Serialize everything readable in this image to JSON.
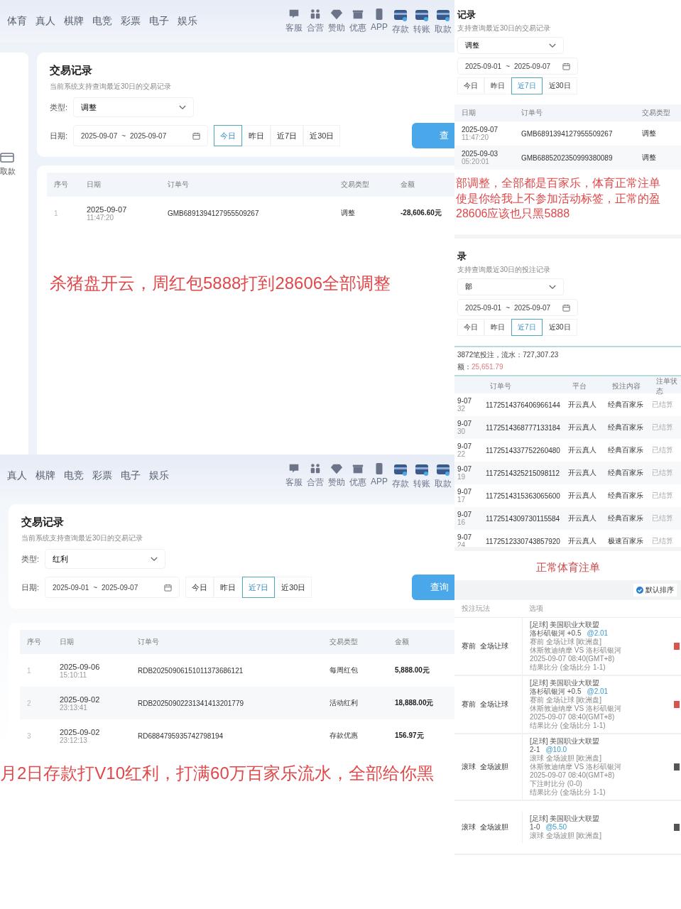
{
  "top_left": {
    "nav_links": [
      "体育",
      "真人",
      "棋牌",
      "电竞",
      "彩票",
      "电子",
      "娱乐"
    ],
    "nav_icons": [
      "客服",
      "合营",
      "赞助",
      "优惠",
      "APP",
      "存款",
      "转账",
      "取款"
    ],
    "sidebar_label": "取款",
    "title": "交易记录",
    "subtitle": "当前系统支持查询最近30日的交易记录",
    "type_label": "类型:",
    "type_value": "调整",
    "date_label": "日期:",
    "date_start": "2025-09-07",
    "date_sep": "~",
    "date_end": "2025-09-07",
    "quick_ranges": [
      {
        "label": "今日",
        "selected": true
      },
      {
        "label": "昨日",
        "selected": false
      },
      {
        "label": "近7日",
        "selected": false
      },
      {
        "label": "近30日",
        "selected": false
      }
    ],
    "query_button": "查",
    "columns": [
      {
        "kind": "index",
        "label": "序号"
      },
      {
        "kind": "date",
        "label": "日期"
      },
      {
        "kind": "order_no",
        "label": "订单号"
      },
      {
        "kind": "type",
        "label": "交易类型"
      },
      {
        "kind": "amount",
        "label": "金额"
      }
    ],
    "rows": [
      {
        "index": "1",
        "date": "2025-09-07",
        "time": "11:47:20",
        "order_no": "GMB6891394127955509267",
        "type": "调整",
        "amount": "-28,606.60元"
      }
    ],
    "annotation": [
      "杀猪盘开云，周红包5888打到28606全部调整"
    ]
  },
  "bottom_left": {
    "nav_links": [
      "真人",
      "棋牌",
      "电竞",
      "彩票",
      "电子",
      "娱乐"
    ],
    "nav_icons": [
      "客服",
      "合营",
      "赞助",
      "优惠",
      "APP",
      "存款",
      "转账",
      "取款"
    ],
    "title": "交易记录",
    "subtitle": "当前系统支持查询最近30日的交易记录",
    "type_label": "类型:",
    "type_value": "红利",
    "date_label": "日期:",
    "date_start": "2025-09-01",
    "date_sep": "~",
    "date_end": "2025-09-07",
    "quick_ranges": [
      {
        "label": "今日",
        "selected": false
      },
      {
        "label": "昨日",
        "selected": false
      },
      {
        "label": "近7日",
        "selected": true
      },
      {
        "label": "近30日",
        "selected": false
      }
    ],
    "query_button": "查询",
    "columns": [
      {
        "kind": "index",
        "label": "序号"
      },
      {
        "kind": "date",
        "label": "日期"
      },
      {
        "kind": "order_no",
        "label": "订单号"
      },
      {
        "kind": "type",
        "label": "交易类型"
      },
      {
        "kind": "amount",
        "label": "金额"
      }
    ],
    "rows": [
      {
        "index": "1",
        "date": "2025-09-06",
        "time": "15:10:11",
        "order_no": "RDB20250906151011373686121",
        "type": "每周红包",
        "amount": "5,888.00元"
      },
      {
        "index": "2",
        "date": "2025-09-02",
        "time": "23:13:41",
        "order_no": "RDB20250902231341413201779",
        "type": "活动红利",
        "amount": "18,888.00元"
      },
      {
        "index": "3",
        "date": "2025-09-02",
        "time": "23:12:13",
        "order_no": "RD6884795935742798194",
        "type": "存款优惠",
        "amount": "156.97元"
      }
    ],
    "annotation": [
      "月2日存款打V10红利，打满60万百家乐流水，全部给你黑"
    ]
  },
  "top_right": {
    "title": "记录",
    "subtitle": "支持查询最近30日的交易记录",
    "type_value": "调整",
    "date_start": "2025-09-01",
    "date_sep": "~",
    "date_end": "2025-09-07",
    "quick_ranges": [
      {
        "label": "今日",
        "selected": false
      },
      {
        "label": "昨日",
        "selected": false
      },
      {
        "label": "近7日",
        "selected": true
      },
      {
        "label": "近30日",
        "selected": false
      }
    ],
    "columns": [
      {
        "kind": "date",
        "label": "日期"
      },
      {
        "kind": "order_no",
        "label": "订单号"
      },
      {
        "kind": "type",
        "label": "交易类型"
      }
    ],
    "rows": [
      {
        "date": "2025-09-07",
        "time": "11:47:20",
        "order_no": "GMB6891394127955509267",
        "type": "调整"
      },
      {
        "date": "2025-09-03",
        "time": "05:20:01",
        "order_no": "GMB6885202350999380089",
        "type": "调整"
      }
    ],
    "annotation": [
      "部调整，全部都是百家乐，体育正常注单",
      "使是你给我上不参加活动标签，正常的盈",
      "28606应该也只黑5888"
    ]
  },
  "middle_right": {
    "title": "录",
    "subtitle": "支持查询最近30日的投注记录",
    "type_value": "部",
    "date_start": "2025-09-01",
    "date_sep": "~",
    "date_end": "2025-09-07",
    "quick_ranges": [
      {
        "label": "今日",
        "selected": false
      },
      {
        "label": "昨日",
        "selected": false
      },
      {
        "label": "近7日",
        "selected": true
      },
      {
        "label": "近30日",
        "selected": false
      }
    ],
    "summary": "3872笔投注，流水：727,307.23",
    "summary_label": "额：",
    "summary_value": "25,651.79",
    "columns": [
      {
        "kind": "date"
      },
      {
        "kind": "order_no",
        "label": "订单号"
      },
      {
        "kind": "platform",
        "label": "平台"
      },
      {
        "kind": "content",
        "label": "投注内容"
      },
      {
        "kind": "status",
        "label": "注单状态"
      }
    ],
    "rows": [
      {
        "date": "9-07",
        "time": "32",
        "order_no": "1172514376406966144",
        "platform": "开云真人",
        "content": "经典百家乐",
        "status": "已结算"
      },
      {
        "date": "9-07",
        "time": "30",
        "order_no": "1172514368777133184",
        "platform": "开云真人",
        "content": "经典百家乐",
        "status": "已结算"
      },
      {
        "date": "9-07",
        "time": "22",
        "order_no": "1172514337752260480",
        "platform": "开云真人",
        "content": "经典百家乐",
        "status": "已结算"
      },
      {
        "date": "9-07",
        "time": "19",
        "order_no": "1172514325215098112",
        "platform": "开云真人",
        "content": "经典百家乐",
        "status": "已结算"
      },
      {
        "date": "9-07",
        "time": "17",
        "order_no": "1172514315363065600",
        "platform": "开云真人",
        "content": "经典百家乐",
        "status": "已结算"
      },
      {
        "date": "9-07",
        "time": "16",
        "order_no": "1172514309730115584",
        "platform": "开云真人",
        "content": "经典百家乐",
        "status": "已结算"
      },
      {
        "date": "9-07",
        "time": "24",
        "order_no": "1172512330743857920",
        "platform": "开云真人",
        "content": "极速百家乐",
        "status": "已结算"
      }
    ]
  },
  "bottom_right": {
    "annotation": "正常体育注单",
    "sort_label": "默认排序",
    "columns": [
      "投注玩法",
      "选项"
    ],
    "rows": [
      {
        "play": "赛前  全场让球",
        "league": "[足球] 美国职业大联盟",
        "pick": "洛杉矶银河 +0.5",
        "odds": "@2.01",
        "details": [
          "赛前  全场让球 [欧洲盘]",
          "休斯敦迪纳摩 VS 洛杉矶银河",
          "2025-09-07 08:40(GMT+8)",
          "结果比分 (全场比分 1-1)"
        ],
        "color": "#d9534f"
      },
      {
        "play": "赛前  全场让球",
        "league": "[足球] 美国职业大联盟",
        "pick": "洛杉矶银河 +0.5",
        "odds": "@2.01",
        "details": [
          "赛前  全场让球 [欧洲盘]",
          "休斯敦迪纳摩 VS 洛杉矶银河",
          "2025-09-07 08:40(GMT+8)",
          "结果比分 (全场比分 1-1)"
        ],
        "color": "#d9534f"
      },
      {
        "play": "滚球  全场波胆",
        "league": "[足球] 美国职业大联盟",
        "pick": "2-1",
        "odds": "@10.0",
        "details": [
          "滚球  全场波胆 [欧洲盘]",
          "休斯敦迪纳摩 VS 洛杉矶银河",
          "2025-09-07 08:40(GMT+8)",
          "下注时比分 (0-0)",
          "结果比分 (全场比分 1-1)"
        ],
        "color": "#555555"
      },
      {
        "play": "滚球  全场波胆",
        "league": "[足球] 美国职业大联盟",
        "pick": "1-0",
        "odds": "@5.50",
        "details": [
          "滚球  全场波胆 [欧洲盘]"
        ],
        "color": "#555555"
      }
    ]
  }
}
